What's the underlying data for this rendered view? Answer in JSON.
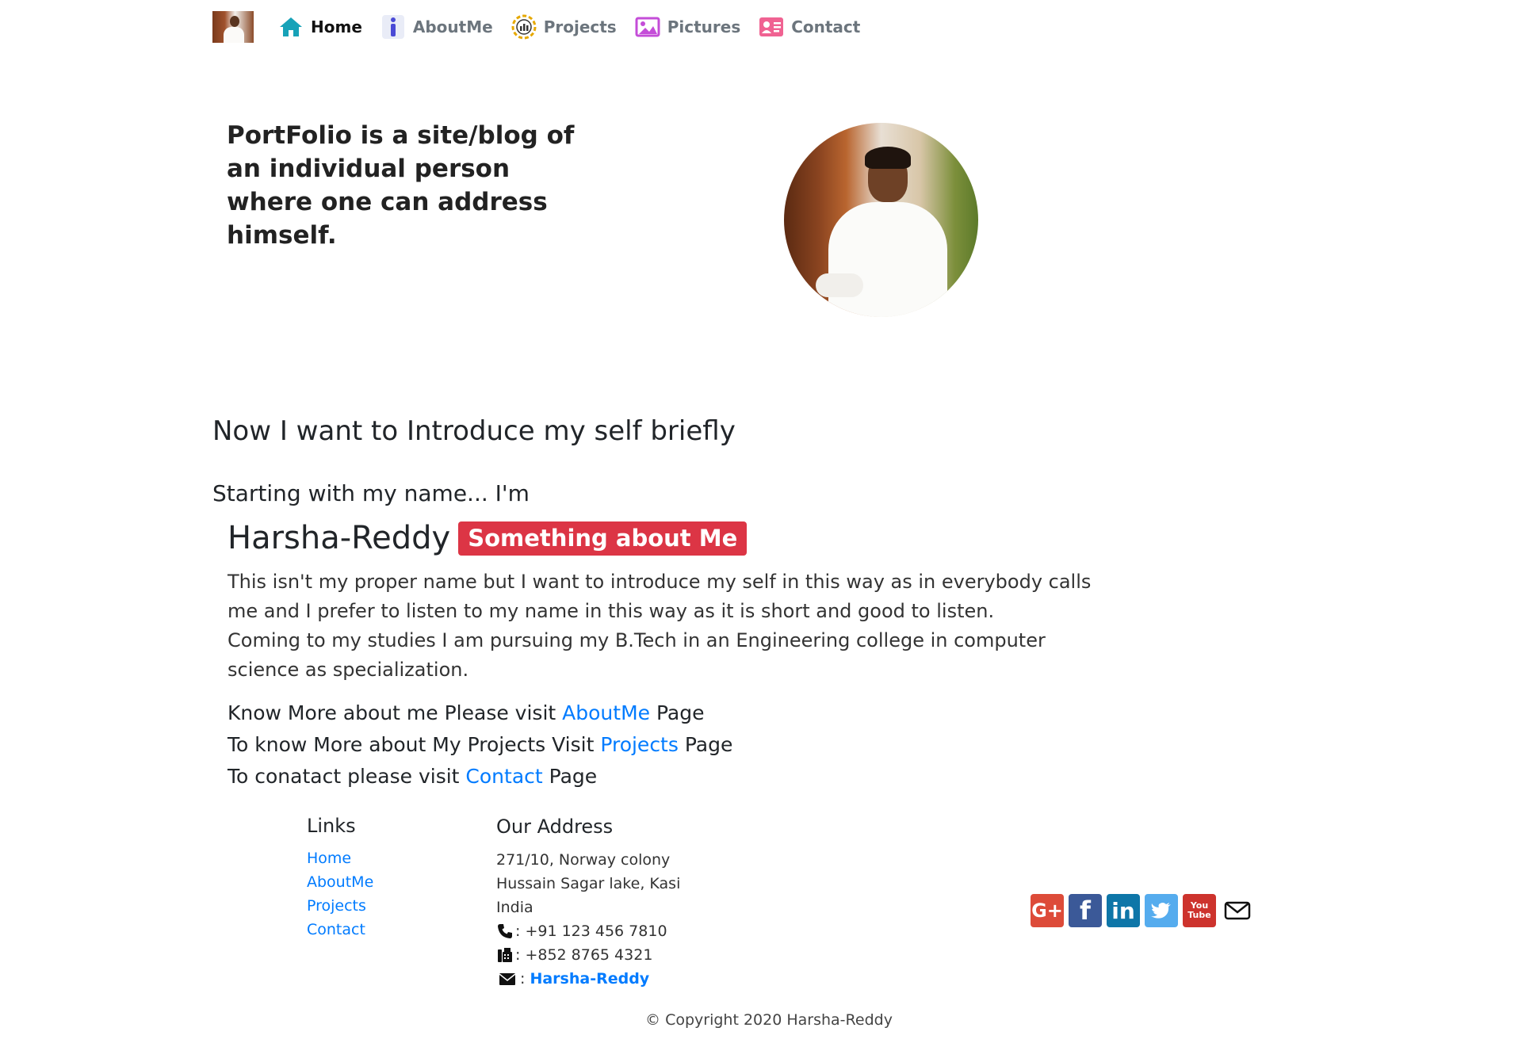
{
  "nav": {
    "items": [
      {
        "label": "Home",
        "icon": "home-icon",
        "color": "#17a2b8"
      },
      {
        "label": "AboutMe",
        "icon": "info-icon",
        "color": "#5b5bd6"
      },
      {
        "label": "Projects",
        "icon": "projects-icon",
        "color": "#e6a800"
      },
      {
        "label": "Pictures",
        "icon": "image-icon",
        "color": "#c44dd8"
      },
      {
        "label": "Contact",
        "icon": "contact-card-icon",
        "color": "#f06292"
      }
    ]
  },
  "hero": {
    "tagline": "PortFolio is a site/blog of an individual person where one can address himself."
  },
  "intro": {
    "heading": "Now I want to Introduce my self briefly",
    "starting": "Starting with my name... I'm",
    "name": "Harsha-Reddy",
    "badge": "Something about Me",
    "badge_color": "#dc3545",
    "paragraph1": "This isn't my proper name but I want to introduce my self in this way as in everybody calls me and I prefer to listen to my name in this way as it is short and good to listen.",
    "paragraph2": "Coming to my studies I am pursuing my B.Tech in an Engineering college in computer science as specialization."
  },
  "visit": [
    {
      "prefix": "Know More about me Please visit",
      "link": "AboutMe",
      "suffix": "Page"
    },
    {
      "prefix": "To know More about My Projects Visit",
      "link": "Projects",
      "suffix": "Page"
    },
    {
      "prefix": "To conatact please visit",
      "link": "Contact",
      "suffix": "Page"
    }
  ],
  "footer": {
    "links_title": "Links",
    "links": [
      "Home",
      "AboutMe",
      "Projects",
      "Contact"
    ],
    "address_title": "Our Address",
    "address_lines": [
      "271/10, Norway colony",
      "Hussain Sagar lake, Kasi",
      "India"
    ],
    "phone": ": +91 123 456 7810",
    "fax": ": +852 8765 4321",
    "email_sep": ":",
    "email": "Harsha-Reddy",
    "social": [
      {
        "icon": "google-plus-icon",
        "label": "G+",
        "color": "#dd4b39"
      },
      {
        "icon": "facebook-icon",
        "label": "f",
        "color": "#3b5998"
      },
      {
        "icon": "linkedin-icon",
        "label": "in",
        "color": "#0e76a8"
      },
      {
        "icon": "twitter-icon",
        "label": "",
        "color": "#55acee"
      },
      {
        "icon": "youtube-icon",
        "label": "You Tube",
        "color": "#cd332d"
      },
      {
        "icon": "mail-icon",
        "label": "",
        "color": "#212529"
      }
    ],
    "copyright": "© Copyright 2020 Harsha-Reddy"
  },
  "colors": {
    "link": "#007bff",
    "text": "#212529"
  }
}
